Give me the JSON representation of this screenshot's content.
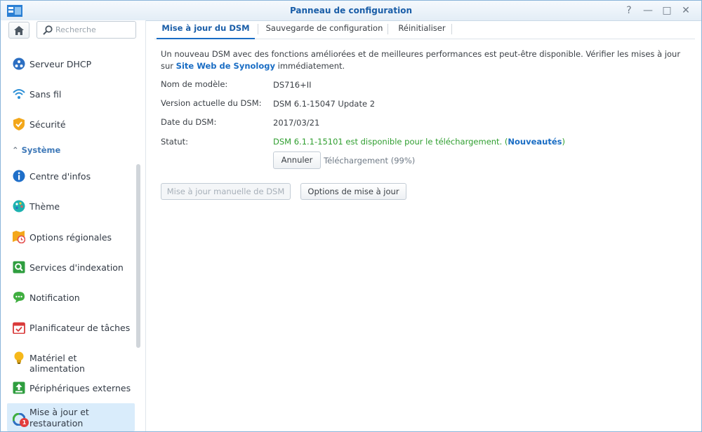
{
  "window": {
    "title": "Panneau de configuration",
    "controls": [
      "?",
      "—",
      "□",
      "✕"
    ]
  },
  "sidebar": {
    "search_placeholder": "Recherche",
    "items_top": [
      {
        "label": "Serveur DHCP",
        "icon": "dhcp-icon"
      },
      {
        "label": "Sans fil",
        "icon": "wifi-icon"
      },
      {
        "label": "Sécurité",
        "icon": "shield-icon"
      }
    ],
    "section": "Système",
    "items": [
      {
        "label": "Centre d'infos",
        "icon": "info-icon"
      },
      {
        "label": "Thème",
        "icon": "palette-icon"
      },
      {
        "label": "Options régionales",
        "icon": "regional-icon"
      },
      {
        "label": "Services d'indexation",
        "icon": "indexing-icon"
      },
      {
        "label": "Notification",
        "icon": "notification-icon"
      },
      {
        "label": "Planificateur de tâches",
        "icon": "calendar-icon"
      },
      {
        "label": "Matériel et alimentation",
        "icon": "lightbulb-icon"
      },
      {
        "label": "Périphériques externes",
        "icon": "external-device-icon"
      },
      {
        "label": "Mise à jour et restauration",
        "icon": "update-restore-icon",
        "badge": "1"
      }
    ]
  },
  "tabs": [
    "Mise à jour du DSM",
    "Sauvegarde de configuration",
    "Réinitialiser"
  ],
  "content": {
    "description_start": "Un nouveau DSM avec des fonctions améliorées et de meilleures performances est peut-être disponible. Vérifier les mises à jour sur ",
    "description_link": "Site Web de Synology",
    "description_end": " immédiatement.",
    "fields": {
      "model_label": "Nom de modèle:",
      "model_value": "DS716+II",
      "version_label": "Version actuelle du DSM:",
      "version_value": "DSM 6.1-15047 Update 2",
      "date_label": "Date du DSM:",
      "date_value": "2017/03/21",
      "status_label": "Statut:",
      "status_text": "DSM 6.1.1-15101 est disponible pour le téléchargement. (",
      "status_link": "Nouveautés",
      "status_close": ")"
    },
    "cancel_button": "Annuler",
    "progress_text": "Téléchargement (99%)",
    "progress_value": 0.99,
    "manual_update_button": "Mise à jour manuelle de DSM",
    "update_options_button": "Options de mise à jour"
  },
  "colors": {
    "accent": "#1a6dc4",
    "status_green": "#2f9e2f",
    "active_bg": "#d9ecfb"
  }
}
